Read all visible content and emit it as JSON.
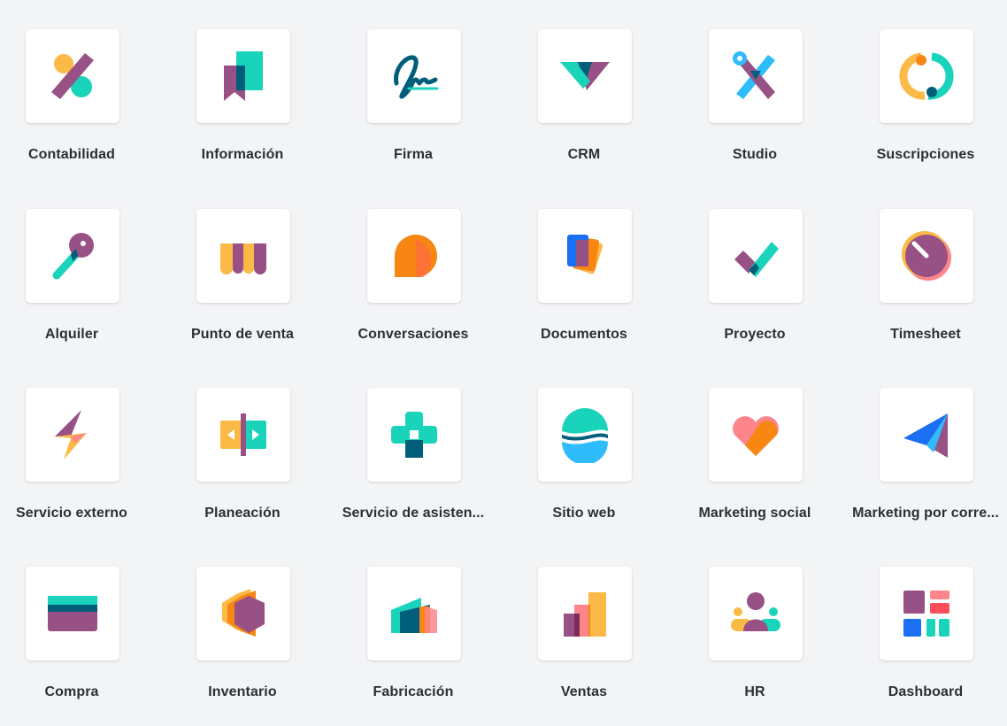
{
  "apps": [
    {
      "label": "Contabilidad",
      "icon": "accounting-icon"
    },
    {
      "label": "Información",
      "icon": "knowledge-icon"
    },
    {
      "label": "Firma",
      "icon": "sign-icon"
    },
    {
      "label": "CRM",
      "icon": "crm-handshake-icon"
    },
    {
      "label": "Studio",
      "icon": "studio-tools-icon"
    },
    {
      "label": "Suscripciones",
      "icon": "subscriptions-icon"
    },
    {
      "label": "Alquiler",
      "icon": "rental-key-icon"
    },
    {
      "label": "Punto de venta",
      "icon": "point-of-sale-awning-icon"
    },
    {
      "label": "Conversaciones",
      "icon": "discuss-bubble-icon"
    },
    {
      "label": "Documentos",
      "icon": "documents-icon"
    },
    {
      "label": "Proyecto",
      "icon": "project-check-icon"
    },
    {
      "label": "Timesheet",
      "icon": "timesheet-dial-icon"
    },
    {
      "label": "Servicio externo",
      "icon": "field-service-bolt-icon"
    },
    {
      "label": "Planeación",
      "icon": "planning-icon"
    },
    {
      "label": "Servicio de asisten...",
      "icon": "helpdesk-cross-icon"
    },
    {
      "label": "Sitio web",
      "icon": "website-globe-icon"
    },
    {
      "label": "Marketing social",
      "icon": "social-heart-icon"
    },
    {
      "label": "Marketing por corre...",
      "icon": "email-plane-icon"
    },
    {
      "label": "Compra",
      "icon": "purchase-card-icon"
    },
    {
      "label": "Inventario",
      "icon": "inventory-cube-icon"
    },
    {
      "label": "Fabricación",
      "icon": "manufacturing-factory-icon"
    },
    {
      "label": "Ventas",
      "icon": "sales-bars-icon"
    },
    {
      "label": "HR",
      "icon": "hr-people-icon"
    },
    {
      "label": "Dashboard",
      "icon": "dashboard-icon"
    }
  ],
  "colors": {
    "purple": "#985184",
    "teal": "#1ad3bb",
    "dark_teal": "#005e7a",
    "orange": "#fc868b",
    "yellow": "#fbb945",
    "tangerine": "#f78613",
    "blue": "#2ebcfa",
    "light_blue": "#1a6ff2"
  }
}
